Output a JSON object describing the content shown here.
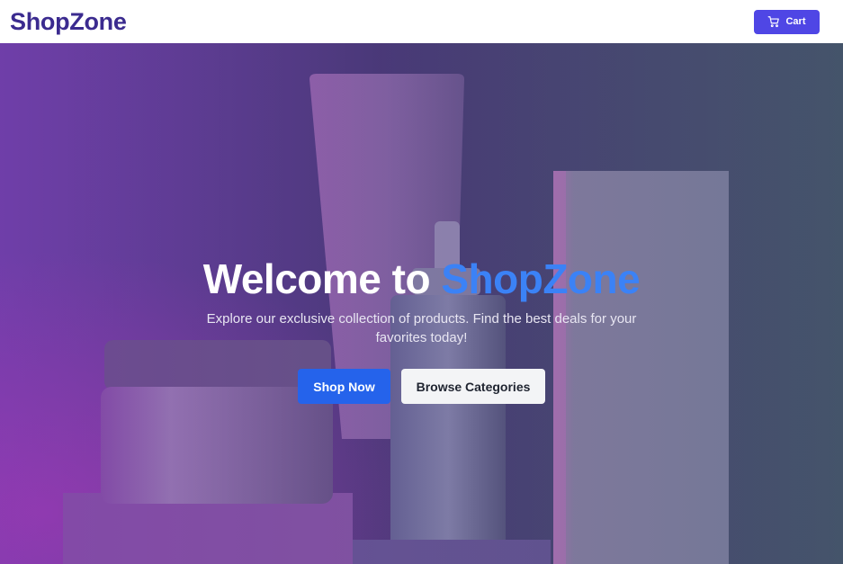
{
  "brand": {
    "name": "ShopZone"
  },
  "nav": {
    "cart_label": "Cart",
    "cart_icon": "shopping-cart-icon"
  },
  "hero": {
    "title_prefix": "Welcome to ",
    "title_accent": "ShopZone",
    "subtitle": "Explore our exclusive collection of products. Find the best deals for your favorites today!",
    "primary_cta": "Shop Now",
    "secondary_cta": "Browse Categories"
  },
  "colors": {
    "brand_text": "#3b2b8f",
    "cart_button": "#4f46e5",
    "accent": "#3b82f6",
    "primary_button": "#2563eb",
    "secondary_button": "#f3f4f6"
  }
}
